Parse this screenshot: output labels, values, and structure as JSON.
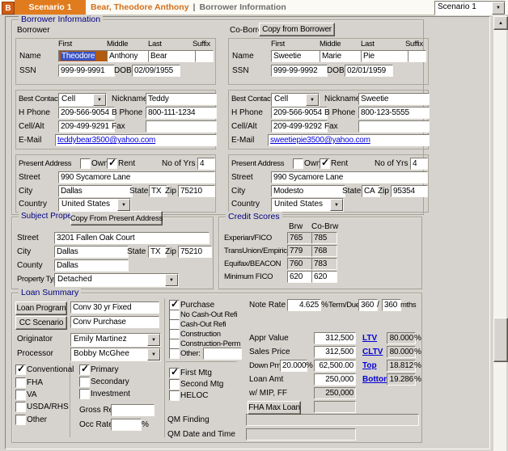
{
  "titlebar": {
    "icon": "B",
    "tab": "Scenario 1",
    "name": "Bear, Theodore Anthony",
    "divider": "|",
    "section": "Borrower Information",
    "scenario_dropdown": "Scenario 1"
  },
  "icons": {
    "dropdown": "▼",
    "scroll_up": "▲"
  },
  "colors": {
    "accent_orange": "#d2701c",
    "group_title_navy": "#000080",
    "link_blue": "#0400d8",
    "window_bg": "#d6d3ce"
  },
  "borrower_information": {
    "title": "Borrower Information",
    "headers": {
      "first": "First",
      "middle": "Middle",
      "last": "Last",
      "suffix": "Suffix"
    },
    "labels": {
      "name": "Name",
      "ssn": "SSN",
      "dob": "DOB",
      "best_contact": "Best Contact",
      "nickname": "Nickname",
      "h_phone": "H Phone",
      "b_phone": "B Phone",
      "cell_alt": "Cell/Alt",
      "fax": "Fax",
      "email": "E-Mail",
      "present_address": "Present Address",
      "own": "Own",
      "rent": "Rent",
      "no_of_yrs": "No of Yrs",
      "street": "Street",
      "city": "City",
      "state": "State",
      "zip": "Zip",
      "country": "Country"
    },
    "borrower": {
      "section_label": "Borrower",
      "first": "Theodore",
      "middle": "Anthony",
      "last": "Bear",
      "suffix": "",
      "ssn": "999-99-9991",
      "dob": "02/09/1955",
      "best_contact": "Cell",
      "nickname": "Teddy",
      "h_phone": "209-566-9054",
      "b_phone": "800-111-1234",
      "cell_alt": "209-499-9291",
      "fax": "",
      "email": "teddybear3500@yahoo.com",
      "own": false,
      "rent": true,
      "no_of_yrs": "4",
      "street": "990 Sycamore Lane",
      "city": "Dallas",
      "state": "TX",
      "zip": "75210",
      "country": "United States"
    },
    "coborrower": {
      "section_label": "Co-Borrower",
      "copy_button": "Copy from Borrower",
      "first": "Sweetie",
      "middle": "Marie",
      "last": "Pie",
      "suffix": "",
      "ssn": "999-99-9992",
      "dob": "02/01/1959",
      "best_contact": "Cell",
      "nickname": "Sweetie",
      "h_phone": "209-566-9054",
      "b_phone": "800-123-5555",
      "cell_alt": "209-499-9292",
      "fax": "",
      "email": "sweetiepie3500@yahoo.com",
      "own": false,
      "rent": true,
      "no_of_yrs": "4",
      "street": "990 Sycamore Lane",
      "city": "Modesto",
      "state": "CA",
      "zip": "95354",
      "country": "United States"
    }
  },
  "subject_property": {
    "title": "Subject Property",
    "copy_button": "Copy From Present Address",
    "labels": {
      "street": "Street",
      "city": "City",
      "state": "State",
      "zip": "Zip",
      "county": "County",
      "property_type": "Property Type"
    },
    "street": "3201 Fallen Oak Court",
    "city": "Dallas",
    "state": "TX",
    "zip": "75210",
    "county": "Dallas",
    "property_type": "Detached"
  },
  "credit_scores": {
    "title": "Credit Scores",
    "col_brw": "Brw",
    "col_cobrw": "Co-Brw",
    "rows": [
      {
        "label": "Experian/FICO",
        "brw": "765",
        "cobrw": "785"
      },
      {
        "label": "TransUnion/Empirica",
        "brw": "779",
        "cobrw": "768"
      },
      {
        "label": "Equifax/BEACON",
        "brw": "760",
        "cobrw": "783"
      },
      {
        "label": "Minimum FICO",
        "brw": "620",
        "cobrw": "620"
      }
    ]
  },
  "loan_summary": {
    "title": "Loan Summary",
    "loan_program_button": "Loan Program",
    "loan_program": "Conv 30 yr Fixed",
    "cc_scenario_button": "CC Scenario",
    "cc_scenario": "Conv Purchase",
    "originator_label": "Originator",
    "originator": "Emily Martinez",
    "processor_label": "Processor",
    "processor": "Bobby McGhee",
    "loan_type": {
      "conventional": {
        "label": "Conventional",
        "checked": true
      },
      "fha": {
        "label": "FHA",
        "checked": false
      },
      "va": {
        "label": "VA",
        "checked": false
      },
      "usda": {
        "label": "USDA/RHS",
        "checked": false
      },
      "other": {
        "label": "Other",
        "checked": false
      }
    },
    "occupancy": {
      "primary": {
        "label": "Primary",
        "checked": true
      },
      "secondary": {
        "label": "Secondary",
        "checked": false
      },
      "investment": {
        "label": "Investment",
        "checked": false
      },
      "gross_rent_label": "Gross Rent",
      "gross_rent": "",
      "occ_rate_label": "Occ Rate",
      "occ_rate": ""
    },
    "purpose": {
      "purchase": {
        "label": "Purchase",
        "checked": true
      },
      "no_cashout": {
        "label": "No Cash-Out Refi",
        "checked": false
      },
      "cashout": {
        "label": "Cash-Out Refi",
        "checked": false
      },
      "construction": {
        "label": "Construction",
        "checked": false
      },
      "construction_perm": {
        "label": "Construction-Perm",
        "checked": false
      },
      "other": {
        "label": "Other:",
        "checked": false,
        "value": ""
      }
    },
    "lien": {
      "first_mtg": {
        "label": "First Mtg",
        "checked": true
      },
      "second_mtg": {
        "label": "Second Mtg",
        "checked": false
      },
      "heloc": {
        "label": "HELOC",
        "checked": false
      }
    },
    "note_rate_label": "Note Rate",
    "note_rate": "4.625",
    "percent": "%",
    "term_due_label": "Term/Due",
    "term": "360",
    "slash": "/",
    "due": "360",
    "mths": "mths",
    "appr_value_label": "Appr Value",
    "appr_value": "312,500",
    "sales_price_label": "Sales Price",
    "sales_price": "312,500",
    "down_pmt_label": "Down Pmt",
    "down_pmt_pct": "20.000",
    "down_pmt": "62,500.00",
    "loan_amt_label": "Loan Amt",
    "loan_amt": "250,000",
    "mip_label": "w/ MIP, FF",
    "mip": "250,000",
    "fha_max_button": "FHA Max Loan",
    "fha_max": "",
    "ltv_label": "LTV",
    "ltv": "80.000",
    "cltv_label": "CLTV",
    "cltv": "80.000",
    "top_label": "Top",
    "top": "18.812",
    "bottom_label": "Bottom",
    "bottom": "19.286",
    "qm_finding_label": "QM Finding",
    "qm_finding": "",
    "qm_datetime_label": "QM Date and Time",
    "qm_datetime": ""
  }
}
